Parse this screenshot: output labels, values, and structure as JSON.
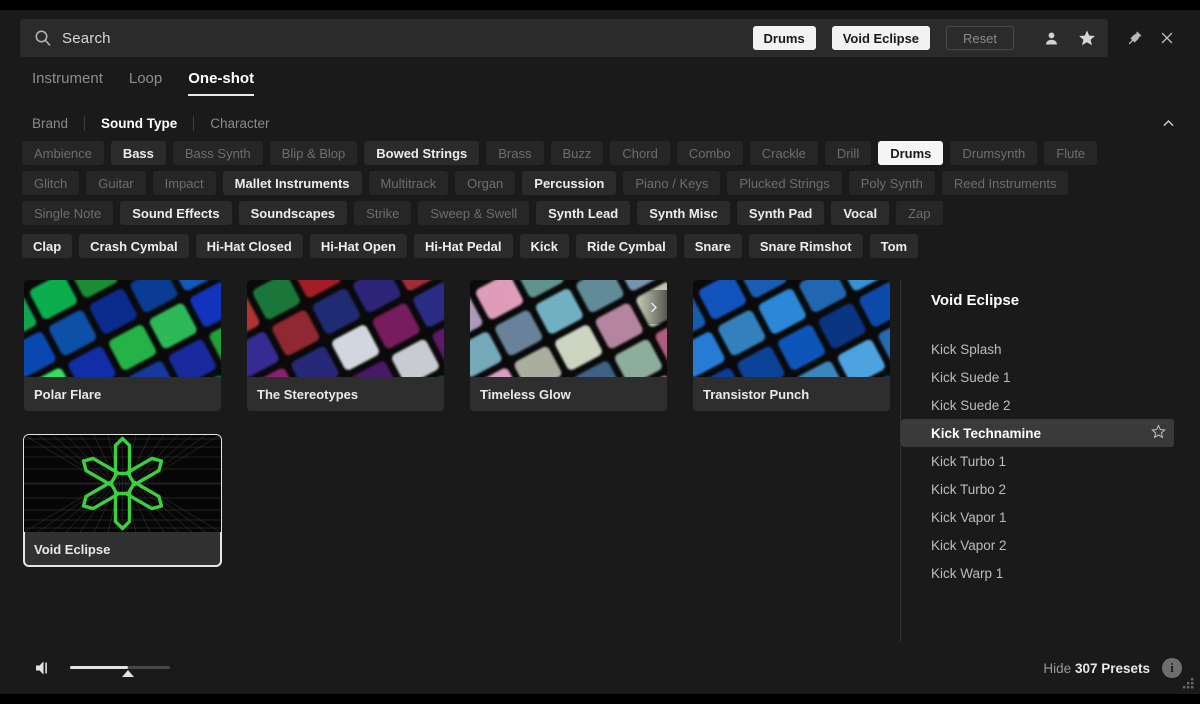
{
  "window": {
    "icons": {
      "pin": "pin-icon",
      "close": "close-icon"
    }
  },
  "search": {
    "placeholder": "Search",
    "value": "",
    "icon": "search-icon",
    "chips": [
      {
        "label": "Drums",
        "style": "filled"
      },
      {
        "label": "Void Eclipse",
        "style": "filled"
      },
      {
        "label": "Reset",
        "style": "reset"
      }
    ],
    "user_icon": "user-icon",
    "favorite_icon": "star-icon"
  },
  "tabs": [
    {
      "label": "Instrument",
      "active": false
    },
    {
      "label": "Loop",
      "active": false
    },
    {
      "label": "One-shot",
      "active": true
    }
  ],
  "filter_categories": [
    {
      "label": "Brand",
      "active": false
    },
    {
      "label": "Sound Type",
      "active": true
    },
    {
      "label": "Character",
      "active": false
    }
  ],
  "collapse_icon": "chevron-up-icon",
  "tags": [
    {
      "label": "Ambience",
      "state": "dim"
    },
    {
      "label": "Bass",
      "state": "enabled"
    },
    {
      "label": "Bass Synth",
      "state": "dim"
    },
    {
      "label": "Blip & Blop",
      "state": "dim"
    },
    {
      "label": "Bowed Strings",
      "state": "enabled"
    },
    {
      "label": "Brass",
      "state": "dim"
    },
    {
      "label": "Buzz",
      "state": "dim"
    },
    {
      "label": "Chord",
      "state": "dim"
    },
    {
      "label": "Combo",
      "state": "dim"
    },
    {
      "label": "Crackle",
      "state": "dim"
    },
    {
      "label": "Drill",
      "state": "dim"
    },
    {
      "label": "Drums",
      "state": "selected"
    },
    {
      "label": "Drumsynth",
      "state": "dim"
    },
    {
      "label": "Flute",
      "state": "dim"
    },
    {
      "label": "Glitch",
      "state": "dim"
    },
    {
      "label": "Guitar",
      "state": "dim"
    },
    {
      "label": "Impact",
      "state": "dim"
    },
    {
      "label": "Mallet Instruments",
      "state": "enabled"
    },
    {
      "label": "Multitrack",
      "state": "dim"
    },
    {
      "label": "Organ",
      "state": "dim"
    },
    {
      "label": "Percussion",
      "state": "enabled"
    },
    {
      "label": "Piano / Keys",
      "state": "dim"
    },
    {
      "label": "Plucked Strings",
      "state": "dim"
    },
    {
      "label": "Poly Synth",
      "state": "dim"
    },
    {
      "label": "Reed Instruments",
      "state": "dim"
    },
    {
      "label": "Single Note",
      "state": "dim"
    },
    {
      "label": "Sound Effects",
      "state": "enabled"
    },
    {
      "label": "Soundscapes",
      "state": "enabled"
    },
    {
      "label": "Strike",
      "state": "dim"
    },
    {
      "label": "Sweep & Swell",
      "state": "dim"
    },
    {
      "label": "Synth Lead",
      "state": "enabled"
    },
    {
      "label": "Synth Misc",
      "state": "enabled"
    },
    {
      "label": "Synth Pad",
      "state": "enabled"
    },
    {
      "label": "Vocal",
      "state": "enabled"
    },
    {
      "label": "Zap",
      "state": "dim"
    }
  ],
  "subtags": [
    "Clap",
    "Crash Cymbal",
    "Hi-Hat Closed",
    "Hi-Hat Open",
    "Hi-Hat Pedal",
    "Kick",
    "Ride Cymbal",
    "Snare",
    "Snare Rimshot",
    "Tom"
  ],
  "products": [
    {
      "title": "Polar Flare",
      "art": "mosaic-green-blue",
      "selected": false,
      "chevron": false
    },
    {
      "title": "The Stereotypes",
      "art": "mosaic-red-purple",
      "selected": false,
      "chevron": false
    },
    {
      "title": "Timeless Glow",
      "art": "mosaic-pastel-pink",
      "selected": false,
      "chevron": true
    },
    {
      "title": "Transistor Punch",
      "art": "mosaic-blue",
      "selected": false,
      "chevron": false
    },
    {
      "title": "Void Eclipse",
      "art": "void-eclipse-logo",
      "selected": true,
      "chevron": false
    }
  ],
  "preset_panel": {
    "title": "Void Eclipse",
    "items": [
      {
        "label": "Kick Splash",
        "active": false
      },
      {
        "label": "Kick Suede 1",
        "active": false
      },
      {
        "label": "Kick Suede 2",
        "active": false
      },
      {
        "label": "Kick Technamine",
        "active": true,
        "star_icon": "star-outline-icon"
      },
      {
        "label": "Kick Turbo 1",
        "active": false
      },
      {
        "label": "Kick Turbo 2",
        "active": false
      },
      {
        "label": "Kick Vapor 1",
        "active": false
      },
      {
        "label": "Kick Vapor 2",
        "active": false
      },
      {
        "label": "Kick Warp 1",
        "active": false
      }
    ]
  },
  "footer": {
    "volume_icon": "speaker-icon",
    "volume_percent": 58,
    "hide_prefix": "Hide ",
    "preset_count_label": "307 Presets",
    "info_icon": "info-icon",
    "info_glyph": "i",
    "resize_grip": "resize-grip-icon"
  },
  "colors": {
    "accent_green": "#3ecf3e",
    "chip_bg": "#f2f2f2",
    "panel_bg": "#1a1a1a"
  }
}
